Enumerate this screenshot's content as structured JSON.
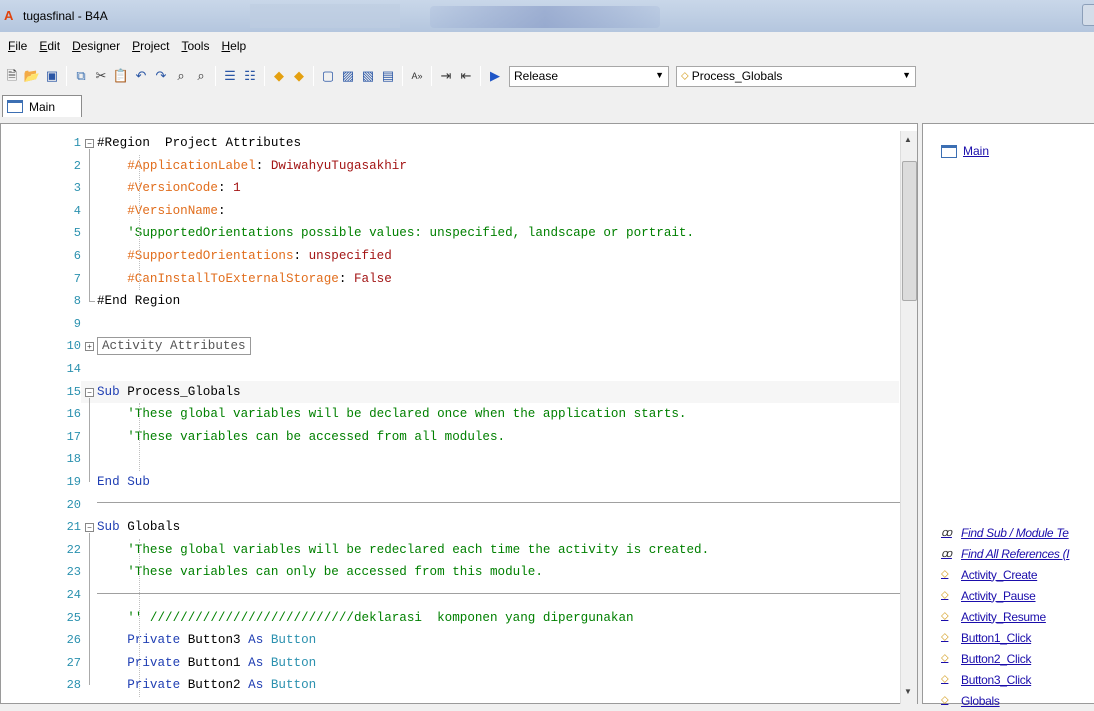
{
  "window": {
    "title": "tugasfinal - B4A",
    "app_icon": "A"
  },
  "menu": [
    "File",
    "Edit",
    "Designer",
    "Project",
    "Tools",
    "Help"
  ],
  "toolbar": {
    "build_config": "Release",
    "sub_selector": "Process_Globals",
    "icons": [
      "new-file-icon",
      "open-folder-icon",
      "save-icon",
      "copy-icon",
      "cut-icon",
      "paste-icon",
      "undo-icon",
      "redo-icon",
      "find-icon",
      "find-all-icon",
      "comment-icon",
      "uncomment-icon",
      "back-icon",
      "forward-icon",
      "bookmark-icon",
      "bookmark-next-icon",
      "bookmark-prev-icon",
      "bookmark-clear-icon",
      "font-size-icon",
      "indent-icon",
      "outdent-icon",
      "run-icon"
    ]
  },
  "tabs": [
    {
      "label": "Main"
    }
  ],
  "editor": {
    "lines": [
      {
        "n": "1",
        "fold": "minus",
        "parts": [
          [
            "plain",
            "#Region  Project Attributes"
          ]
        ]
      },
      {
        "n": "2",
        "parts": [
          [
            "plain",
            "    "
          ],
          [
            "dir",
            "#ApplicationLabel"
          ],
          [
            "plain",
            ": "
          ],
          [
            "val",
            "DwiwahyuTugasakhir"
          ]
        ]
      },
      {
        "n": "3",
        "parts": [
          [
            "plain",
            "    "
          ],
          [
            "dir",
            "#VersionCode"
          ],
          [
            "plain",
            ": "
          ],
          [
            "val",
            "1"
          ]
        ]
      },
      {
        "n": "4",
        "parts": [
          [
            "plain",
            "    "
          ],
          [
            "dir",
            "#VersionName"
          ],
          [
            "plain",
            ":"
          ]
        ]
      },
      {
        "n": "5",
        "parts": [
          [
            "plain",
            "    "
          ],
          [
            "cmt",
            "'SupportedOrientations possible values: unspecified, landscape or portrait."
          ]
        ]
      },
      {
        "n": "6",
        "parts": [
          [
            "plain",
            "    "
          ],
          [
            "dir",
            "#SupportedOrientations"
          ],
          [
            "plain",
            ": "
          ],
          [
            "val",
            "unspecified"
          ]
        ]
      },
      {
        "n": "7",
        "parts": [
          [
            "plain",
            "    "
          ],
          [
            "dir",
            "#CanInstallToExternalStorage"
          ],
          [
            "plain",
            ": "
          ],
          [
            "val",
            "False"
          ]
        ]
      },
      {
        "n": "8",
        "fold": "end",
        "parts": [
          [
            "plain",
            "#End Region"
          ]
        ]
      },
      {
        "n": "9",
        "parts": []
      },
      {
        "n": "10",
        "fold": "plus",
        "parts": [
          [
            "box",
            "Activity Attributes"
          ]
        ]
      },
      {
        "n": "14",
        "parts": []
      },
      {
        "n": "15",
        "fold": "minus",
        "parts": [
          [
            "kw",
            "Sub "
          ],
          [
            "plain",
            "Process_Globals"
          ]
        ]
      },
      {
        "n": "16",
        "parts": [
          [
            "plain",
            "    "
          ],
          [
            "cmt",
            "'These global variables will be declared once when the application starts."
          ]
        ]
      },
      {
        "n": "17",
        "parts": [
          [
            "plain",
            "    "
          ],
          [
            "cmt",
            "'These variables can be accessed from all modules."
          ]
        ]
      },
      {
        "n": "18",
        "parts": []
      },
      {
        "n": "19",
        "parts": [
          [
            "kw",
            "End Sub"
          ]
        ]
      },
      {
        "n": "20",
        "parts": []
      },
      {
        "n": "21",
        "fold": "minus",
        "parts": [
          [
            "kw",
            "Sub "
          ],
          [
            "plain",
            "Globals"
          ]
        ]
      },
      {
        "n": "22",
        "parts": [
          [
            "plain",
            "    "
          ],
          [
            "cmt",
            "'These global variables will be redeclared each time the activity is created."
          ]
        ]
      },
      {
        "n": "23",
        "parts": [
          [
            "plain",
            "    "
          ],
          [
            "cmt",
            "'These variables can only be accessed from this module."
          ]
        ]
      },
      {
        "n": "24",
        "parts": []
      },
      {
        "n": "25",
        "parts": [
          [
            "plain",
            "    "
          ],
          [
            "cmt",
            "'' ///////////////////////////deklarasi  komponen yang dipergunakan"
          ]
        ]
      },
      {
        "n": "26",
        "parts": [
          [
            "plain",
            "    "
          ],
          [
            "kw",
            "Private "
          ],
          [
            "plain",
            "Button3 "
          ],
          [
            "kw",
            "As "
          ],
          [
            "type",
            "Button"
          ]
        ]
      },
      {
        "n": "27",
        "parts": [
          [
            "plain",
            "    "
          ],
          [
            "kw",
            "Private "
          ],
          [
            "plain",
            "Button1 "
          ],
          [
            "kw",
            "As "
          ],
          [
            "type",
            "Button"
          ]
        ]
      },
      {
        "n": "28",
        "parts": [
          [
            "plain",
            "    "
          ],
          [
            "kw",
            "Private "
          ],
          [
            "plain",
            "Button2 "
          ],
          [
            "kw",
            "As "
          ],
          [
            "type",
            "Button"
          ]
        ]
      }
    ]
  },
  "right_panel": {
    "module": "Main",
    "items": [
      {
        "label": "Find Sub / Module Te",
        "icon": "binoculars-icon",
        "italic": true
      },
      {
        "label": "Find All References (I",
        "icon": "binoculars-icon",
        "italic": true
      },
      {
        "label": "Activity_Create",
        "icon": "sub-icon"
      },
      {
        "label": "Activity_Pause",
        "icon": "sub-icon"
      },
      {
        "label": "Activity_Resume",
        "icon": "sub-icon"
      },
      {
        "label": "Button1_Click",
        "icon": "sub-icon"
      },
      {
        "label": "Button2_Click",
        "icon": "sub-icon"
      },
      {
        "label": "Button3_Click",
        "icon": "sub-icon"
      },
      {
        "label": "Globals",
        "icon": "sub-icon"
      }
    ]
  }
}
